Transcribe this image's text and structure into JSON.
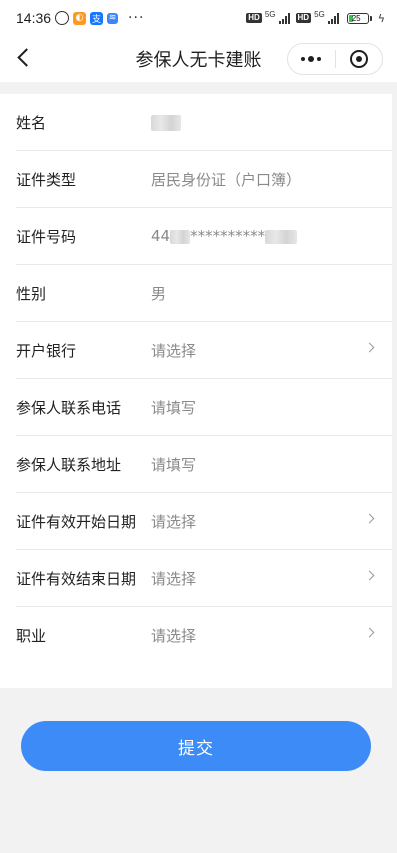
{
  "status_bar": {
    "time": "14:36",
    "hd1": "HD",
    "net1": "5G",
    "hd2": "HD",
    "net2": "5G",
    "battery": "25",
    "more": "···"
  },
  "nav": {
    "title": "参保人无卡建账"
  },
  "form": {
    "rows": [
      {
        "label": "姓名",
        "value": ""
      },
      {
        "label": "证件类型",
        "value": "居民身份证（户口簿）"
      },
      {
        "label": "证件号码",
        "value_prefix": "44",
        "value_mid": "**********"
      },
      {
        "label": "性别",
        "value": "男"
      },
      {
        "label": "开户银行",
        "value": "请选择"
      },
      {
        "label": "参保人联系电话",
        "value": "请填写"
      },
      {
        "label": "参保人联系地址",
        "value": "请填写"
      },
      {
        "label": "证件有效开始日期",
        "value": "请选择"
      },
      {
        "label": "证件有效结束日期",
        "value": "请选择"
      },
      {
        "label": "职业",
        "value": "请选择"
      }
    ]
  },
  "submit_label": "提交",
  "colors": {
    "primary": "#3d8bf7",
    "placeholder": "#8a8a8a",
    "background": "#f2f2f2"
  }
}
